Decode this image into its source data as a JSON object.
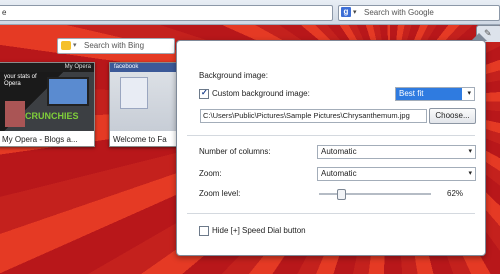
{
  "browser": {
    "search_placeholder": "Search with Google",
    "search_engine_glyph": "g"
  },
  "page": {
    "search_placeholder": "Search with Bing"
  },
  "speed_dial": {
    "thumbnails": [
      {
        "caption": "My Opera - Blogs a...",
        "strip_text": "My Opera",
        "title": "your stats of Opera",
        "badge": "CRUNCHIES"
      },
      {
        "caption": "Welcome to Fa",
        "header_text": "facebook"
      }
    ]
  },
  "settings": {
    "background_heading": "Background image:",
    "custom_bg_label": "Custom background image:",
    "custom_bg_checked": true,
    "fit_value": "Best fit",
    "path_value": "C:\\Users\\Public\\Pictures\\Sample Pictures\\Chrysanthemum.jpg",
    "choose_label": "Choose...",
    "columns_label": "Number of columns:",
    "columns_value": "Automatic",
    "zoom_label": "Zoom:",
    "zoom_value": "Automatic",
    "zoom_level_label": "Zoom level:",
    "zoom_level_value": "62%",
    "zoom_level_fraction": 0.2,
    "hide_button_label": "Hide [+] Speed Dial button",
    "hide_button_checked": false
  },
  "colors": {
    "accent": "#2f7be0",
    "wallpaper": "#c4211d"
  }
}
